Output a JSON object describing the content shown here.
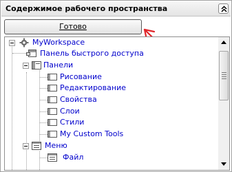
{
  "header": {
    "title": "Содержимое рабочего пространства",
    "collapse_icon": "double-chevron-up-icon"
  },
  "done_button": {
    "label": "Готово"
  },
  "annotation": {
    "color": "#e0262a"
  },
  "tree": {
    "root": {
      "label": "MyWorkspace",
      "icon": "gear-icon"
    },
    "items": [
      {
        "label": "Панель быстрого доступа",
        "icon": "quick-access-toolbar-icon"
      },
      {
        "label": "Панели",
        "icon": "toolbars-icon"
      },
      {
        "label": "Рисование",
        "icon": "toolbar-icon"
      },
      {
        "label": "Редактирование",
        "icon": "toolbar-icon"
      },
      {
        "label": "Свойства",
        "icon": "toolbar-icon"
      },
      {
        "label": "Слои",
        "icon": "toolbar-icon"
      },
      {
        "label": "Стили",
        "icon": "toolbar-icon"
      },
      {
        "label": "My Custom Tools",
        "icon": "toolbar-icon"
      },
      {
        "label": "Меню",
        "icon": "menus-icon"
      },
      {
        "label": "Файл",
        "icon": "menu-icon"
      }
    ]
  },
  "colors": {
    "link": "#0000cc",
    "border": "#a0a0a0"
  }
}
